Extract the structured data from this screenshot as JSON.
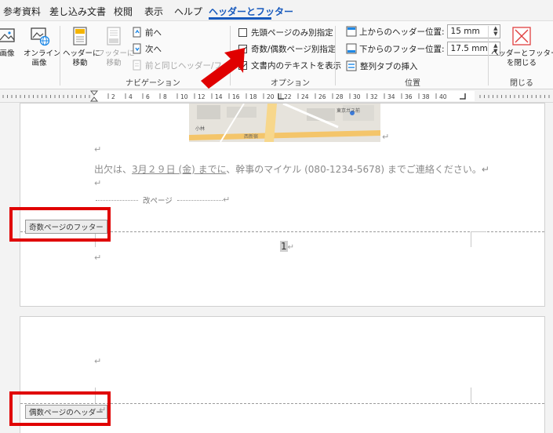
{
  "tabs": [
    "参考資料",
    "差し込み文書",
    "校閲",
    "表示",
    "ヘルプ",
    "ヘッダーとフッター"
  ],
  "active_tab": "ヘッダーとフッター",
  "ribbon": {
    "insert_group": {
      "image_label": "画像",
      "online_image_label_1": "オンライン",
      "online_image_label_2": "画像"
    },
    "nav_group": {
      "label": "ナビゲーション",
      "goto_header_1": "ヘッダーに",
      "goto_header_2": "移動",
      "goto_footer_1": "フッターに",
      "goto_footer_2": "移動",
      "prev": "前へ",
      "next": "次へ",
      "link_previous": "前と同じヘッダー/フッ"
    },
    "options_group": {
      "label": "オプション",
      "first_page": "先頭ページのみ別指定",
      "first_page_checked": false,
      "odd_even": "奇数/偶数ページ別指定",
      "odd_even_checked": true,
      "show_text": "文書内のテキストを表示",
      "show_text_checked": true
    },
    "position_group": {
      "label": "位置",
      "header_pos_label": "上からのヘッダー位置:",
      "header_pos_value": "15 mm",
      "footer_pos_label": "下からのフッター位置:",
      "footer_pos_value": "17.5 mm",
      "align_tab": "整列タブの挿入"
    },
    "close_group": {
      "label": "閉じる",
      "close_1": "ヘッダーとフッター",
      "close_2": "を閉じる"
    }
  },
  "ruler": {
    "ticks": [
      "2",
      "4",
      "6",
      "8",
      "10",
      "12",
      "14",
      "16",
      "18",
      "20",
      "22",
      "24",
      "26",
      "28",
      "30",
      "32",
      "34",
      "36",
      "38",
      "40"
    ]
  },
  "page1": {
    "map_labels": [
      "東京ガス前",
      "小林",
      "西新宿"
    ],
    "body_text_prefix": "出欠は、",
    "body_text_underlined": "3月２９日 (金) までに",
    "body_text_suffix": "、幹事のマイケル (080-1234-5678) までご連絡ください。↵",
    "page_break": "改ページ",
    "footer_tag": "奇数ページのフッター",
    "page_number": "1"
  },
  "page2": {
    "header_tag": "偶数ページのヘッダー"
  },
  "colors": {
    "accent": "#185abd",
    "highlight": "#e00000"
  }
}
